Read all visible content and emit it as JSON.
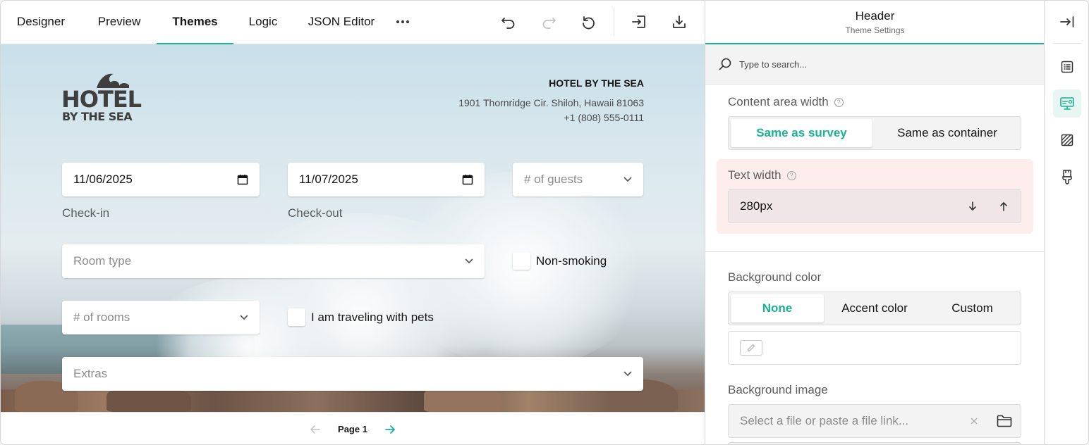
{
  "toolbar": {
    "tabs": [
      {
        "label": "Designer"
      },
      {
        "label": "Preview"
      },
      {
        "label": "Themes",
        "active": true
      },
      {
        "label": "Logic"
      },
      {
        "label": "JSON Editor"
      }
    ],
    "more_icon": "ellipsis-icon",
    "actions": [
      "undo-icon",
      "redo-icon",
      "reset-icon",
      "import-icon",
      "download-icon"
    ]
  },
  "survey": {
    "logo": {
      "line1": "HOTEL",
      "line2": "BY THE SEA"
    },
    "hotel_name": "HOTEL BY THE SEA",
    "address": "1901 Thornridge Cir. Shiloh, Hawaii 81063",
    "phone": "+1 (808) 555-0111",
    "checkin": {
      "value": "11/06/2025",
      "label": "Check-in"
    },
    "checkout": {
      "value": "11/07/2025",
      "label": "Check-out"
    },
    "guests": {
      "placeholder": "# of guests"
    },
    "room_type": {
      "placeholder": "Room type"
    },
    "non_smoking": {
      "label": "Non-smoking"
    },
    "rooms": {
      "placeholder": "# of rooms"
    },
    "pets": {
      "label": "I am traveling with pets"
    },
    "extras": {
      "placeholder": "Extras"
    }
  },
  "pager": {
    "label": "Page 1"
  },
  "panel": {
    "title": "Header",
    "subtitle": "Theme Settings",
    "search_placeholder": "Type to search...",
    "content_width": {
      "label": "Content area width",
      "options": [
        "Same as survey",
        "Same as container"
      ],
      "selected": "Same as survey"
    },
    "text_width": {
      "label": "Text width",
      "value": "280px"
    },
    "background_color": {
      "label": "Background color",
      "options": [
        "None",
        "Accent color",
        "Custom"
      ],
      "selected": "None"
    },
    "background_image": {
      "label": "Background image",
      "placeholder": "Select a file or paste a file link..."
    }
  },
  "colors": {
    "accent": "#19b394",
    "highlight": "#fdeded"
  }
}
